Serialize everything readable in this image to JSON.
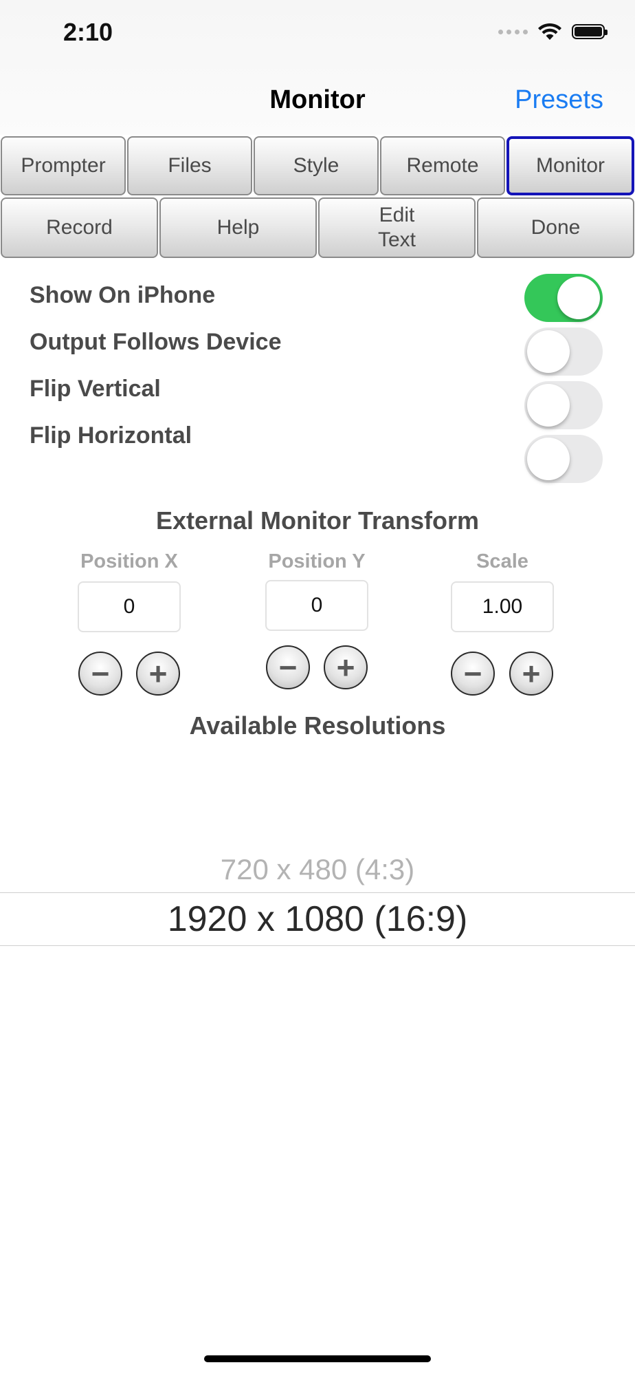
{
  "status_bar": {
    "time": "2:10",
    "icons": [
      "cellular-signal-icon",
      "wifi-icon",
      "battery-icon"
    ]
  },
  "nav": {
    "title": "Monitor",
    "right_button": "Presets"
  },
  "tabs": {
    "row1": [
      "Prompter",
      "Files",
      "Style",
      "Remote",
      "Monitor"
    ],
    "row2": [
      "Record",
      "Help",
      "Edit\nText",
      "Done"
    ],
    "active": "Monitor"
  },
  "settings": [
    {
      "label": "Show On iPhone",
      "on": true
    },
    {
      "label": "Output Follows Device",
      "on": false
    },
    {
      "label": "Flip Vertical",
      "on": false
    },
    {
      "label": "Flip Horizontal",
      "on": false
    }
  ],
  "transform": {
    "heading": "External Monitor Transform",
    "fields": [
      {
        "label": "Position X",
        "value": "0",
        "minus": "−",
        "plus": "+"
      },
      {
        "label": "Position Y",
        "value": "0",
        "minus": "−",
        "plus": "+"
      },
      {
        "label": "Scale",
        "value": "1.00",
        "minus": "−",
        "plus": "+"
      }
    ]
  },
  "resolutions": {
    "heading": "Available Resolutions",
    "options": [
      "720 x 480 (4:3)",
      "1920 x 1080 (16:9)"
    ],
    "selected": "1920 x 1080 (16:9)"
  },
  "colors": {
    "accent_blue": "#1a7cf2",
    "active_tab_border": "#1414b8",
    "toggle_on": "#34c759"
  }
}
